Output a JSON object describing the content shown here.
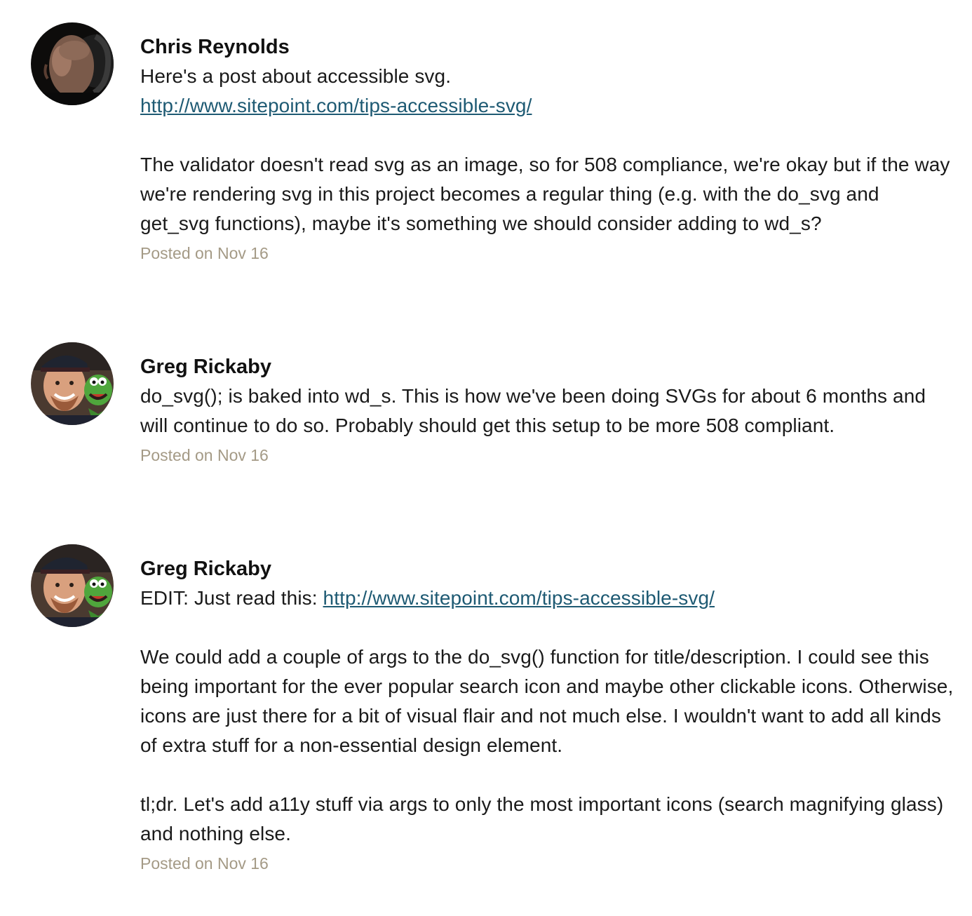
{
  "comments": [
    {
      "avatar": "avatar-icon-chris-reynolds",
      "author": "Chris Reynolds",
      "para1_text": "Here's a post about accessible svg.",
      "para1_link": "http://www.sitepoint.com/tips-accessible-svg/",
      "para2_text": "The validator doesn't read svg as an image, so for 508 compliance, we're okay but if the way we're rendering svg in this project becomes a regular thing (e.g. with the do_svg and get_svg functions), maybe it's something we should consider adding to wd_s?",
      "meta": "Posted on Nov 16"
    },
    {
      "avatar": "avatar-icon-greg-rickaby",
      "author": "Greg Rickaby",
      "para1_text": "do_svg(); is baked into wd_s. This is how we've been doing SVGs for about 6 months and will continue to do so. Probably should get this setup to be more 508 compliant.",
      "meta": "Posted on Nov 16"
    },
    {
      "avatar": "avatar-icon-greg-rickaby",
      "author": "Greg Rickaby",
      "para1_prefix": "EDIT: Just read this: ",
      "para1_link": "http://www.sitepoint.com/tips-accessible-svg/",
      "para2_text": "We could add a couple of args to the do_svg() function for title/description. I could see this being important for the ever popular search icon and maybe other clickable icons. Otherwise, icons are just there for a bit of visual flair and not much else. I wouldn't want to add all kinds of extra stuff for a non-essential design element.",
      "para3_text": "tl;dr. Let's add a11y stuff via args to only the most important icons (search magnifying glass) and nothing else.",
      "meta": "Posted on Nov 16"
    }
  ],
  "colors": {
    "link": "#1e5a73",
    "meta": "#a49a86",
    "author": "#111111",
    "text": "#1a1a1a"
  }
}
